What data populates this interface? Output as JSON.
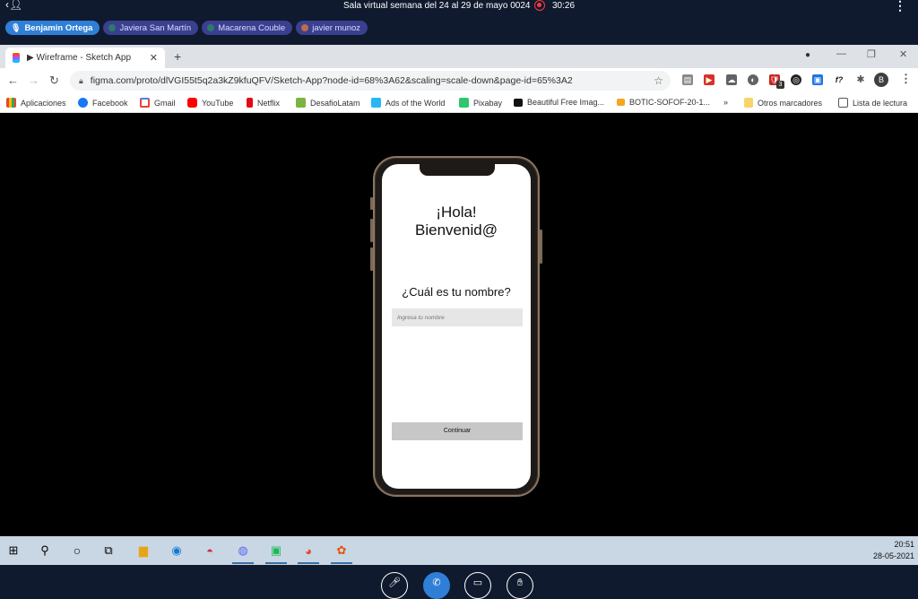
{
  "meeting": {
    "title": "Sala virtual semana del 24 al 29 de mayo 0024",
    "timer": "30:26",
    "participants": [
      {
        "name": "Benjamin Ortega",
        "active": true
      },
      {
        "name": "Javiera San Martín",
        "active": false
      },
      {
        "name": "Macarena Couble",
        "active": false
      },
      {
        "name": "javier munoz",
        "active": false
      }
    ],
    "icons": [
      "back-person-icon",
      "record-icon",
      "more-vert-icon"
    ]
  },
  "browser": {
    "tab_title": "▶ Wireframe - Sketch App",
    "url": "figma.com/proto/dlVGI55t5q2a3kZ9kfuQFV/Sketch-App?node-id=68%3A62&scaling=scale-down&page-id=65%3A2",
    "profile_initial": "B",
    "ext_badge": "3",
    "bookmarks": [
      {
        "label": "Aplicaciones",
        "color": "#4285f4"
      },
      {
        "label": "Facebook",
        "color": "#1877f2"
      },
      {
        "label": "Gmail",
        "color": "#ea4335"
      },
      {
        "label": "YouTube",
        "color": "#ff0000"
      },
      {
        "label": "Netflix",
        "color": "#e50914"
      },
      {
        "label": "DesafioLatam",
        "color": "#7cb342"
      },
      {
        "label": "Ads of the World",
        "color": "#29b6f6"
      },
      {
        "label": "Pixabay",
        "color": "#2ec66e"
      },
      {
        "label": "Beautiful Free Imag...",
        "color": "#111111"
      },
      {
        "label": "BOTIC-SOFOF-20-1...",
        "color": "#f5a623"
      }
    ],
    "bookmarks_overflow": "»",
    "other_bookmarks": "Otros marcadores",
    "reading_list": "Lista de lectura"
  },
  "app": {
    "greeting_line1": "¡Hola!",
    "greeting_line2": "Bienvenid@",
    "question": "¿Cuál es tu nombre?",
    "input_placeholder": "Ingresa tu nombre",
    "continue_label": "Continuar"
  },
  "taskbar": {
    "time": "20:51",
    "date": "28-05-2021"
  }
}
